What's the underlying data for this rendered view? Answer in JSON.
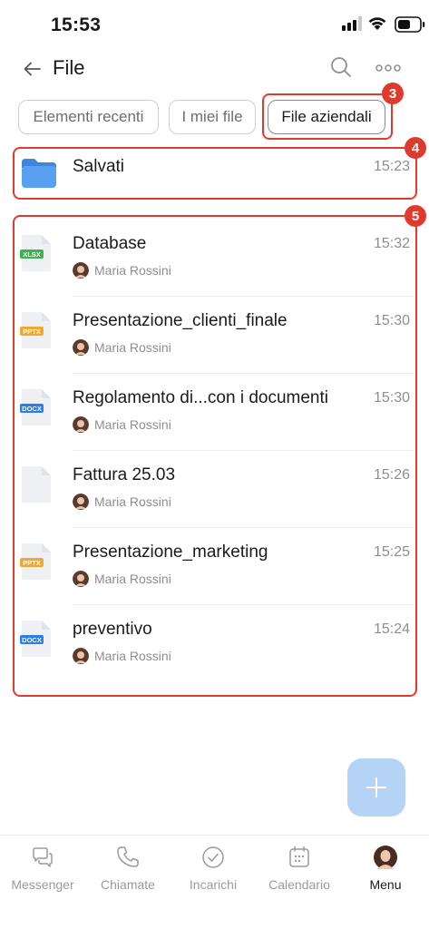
{
  "status_bar": {
    "time": "15:53"
  },
  "header": {
    "title": "File"
  },
  "tabs": [
    {
      "label": "Elementi recenti"
    },
    {
      "label": "I miei file"
    },
    {
      "label": "File aziendali"
    }
  ],
  "callouts": [
    "3",
    "4",
    "5"
  ],
  "folder": {
    "name": "Salvati",
    "time": "15:23"
  },
  "files": [
    {
      "name": "Database",
      "time": "15:32",
      "owner": "Maria Rossini",
      "type": "XLSX"
    },
    {
      "name": "Presentazione_clienti_finale",
      "time": "15:30",
      "owner": "Maria Rossini",
      "type": "PPTX"
    },
    {
      "name": "Regolamento di...con i documenti",
      "time": "15:30",
      "owner": "Maria Rossini",
      "type": "DOCX"
    },
    {
      "name": "Fattura 25.03",
      "time": "15:26",
      "owner": "Maria Rossini",
      "type": ""
    },
    {
      "name": "Presentazione_marketing",
      "time": "15:25",
      "owner": "Maria Rossini",
      "type": "PPTX"
    },
    {
      "name": "preventivo",
      "time": "15:24",
      "owner": "Maria Rossini",
      "type": "DOCX"
    }
  ],
  "bottom_nav": [
    {
      "label": "Messenger",
      "icon": "messenger-icon"
    },
    {
      "label": "Chiamate",
      "icon": "phone-icon"
    },
    {
      "label": "Incarichi",
      "icon": "check-circle-icon"
    },
    {
      "label": "Calendario",
      "icon": "calendar-icon"
    },
    {
      "label": "Menu",
      "icon": "avatar-icon"
    }
  ],
  "colors": {
    "highlight": "#e03a2e",
    "fab": "#b4d3f5",
    "folder": "#4a90e2",
    "xlsx": "#3cb44b",
    "pptx": "#f0a830",
    "docx": "#2b7de9"
  }
}
